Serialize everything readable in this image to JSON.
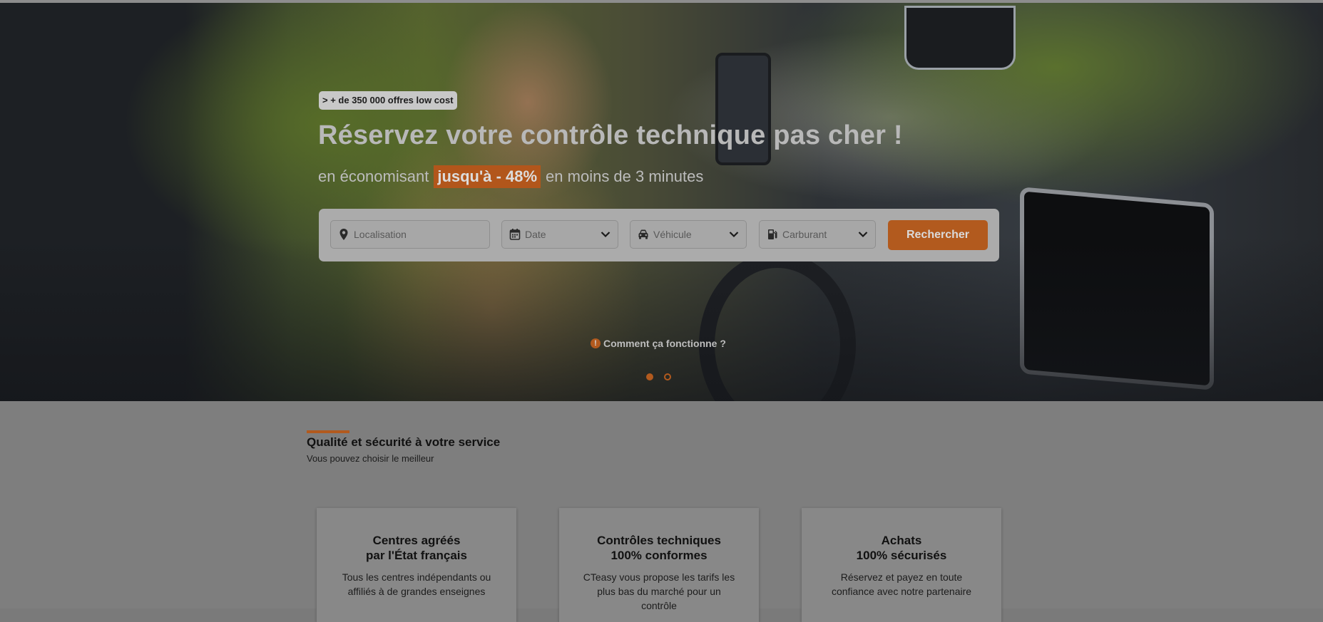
{
  "hero": {
    "badge": "> + de 350 000 offres low cost",
    "headline": "Réservez votre contrôle technique pas cher !",
    "subline_before": "en économisant",
    "subline_highlight": "jusqu'à - 48%",
    "subline_after": "en moins de 3 minutes",
    "how_it_works": "Comment ça fonctionne ?",
    "carousel_active_index": 1,
    "carousel_count": 2
  },
  "search": {
    "location_placeholder": "Localisation",
    "date_label": "Date",
    "vehicle_label": "Véhicule",
    "fuel_label": "Carburant",
    "submit_label": "Rechercher"
  },
  "quality": {
    "title": "Qualité et sécurité à votre service",
    "subtitle": "Vous pouvez choisir le meilleur",
    "cards": [
      {
        "title_line1": "Centres agréés",
        "title_line2": "par l'État français",
        "text": "Tous les centres indépendants ou affiliés à de grandes enseignes"
      },
      {
        "title_line1": "Contrôles techniques",
        "title_line2": "100% conformes",
        "text": "CTeasy vous propose les tarifs les plus bas du marché pour un contrôle"
      },
      {
        "title_line1": "Achats",
        "title_line2": "100% sécurisés",
        "text": "Réservez et payez en toute confiance avec notre partenaire"
      }
    ]
  },
  "colors": {
    "accent": "#b25a1e",
    "overlay_gray": "#7e7e7e"
  },
  "icons": {
    "location": "map-pin-icon",
    "date": "calendar-icon",
    "vehicle": "car-icon",
    "fuel": "fuel-pump-icon",
    "dropdown": "chevron-down-icon",
    "info": "info-circle-icon"
  }
}
